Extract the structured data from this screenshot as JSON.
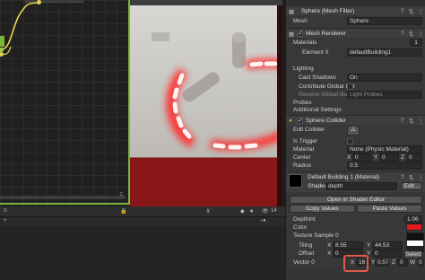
{
  "inspector": {
    "top_tabs": [
      "Tag",
      "Layer"
    ],
    "mesh_filter": {
      "title": "Sphere (Mesh Filter)",
      "mesh_label": "Mesh",
      "mesh_value": "Sphere"
    },
    "mesh_renderer": {
      "title": "Mesh Renderer",
      "materials_label": "Materials",
      "materials_count": "1",
      "element0_label": "Element 0",
      "element0_value": "defaultBuilding1",
      "lighting_label": "Lighting",
      "cast_shadows_label": "Cast Shadows",
      "cast_shadows_value": "On",
      "contribute_gi_label": "Contribute Global Illur",
      "receive_gi_label": "Receive Global Illumi",
      "receive_gi_value": "Light Probes",
      "probes_label": "Probes",
      "additional_label": "Additional Settings"
    },
    "sphere_collider": {
      "title": "Sphere Collider",
      "edit_collider_label": "Edit Collider",
      "is_trigger_label": "Is Trigger",
      "material_label": "Material",
      "material_value": "None (Physic Material)",
      "center_label": "Center",
      "center": {
        "x": "0",
        "y": "0",
        "z": "0"
      },
      "radius_label": "Radius",
      "radius_value": "0.5"
    },
    "material": {
      "title": "Default Building 1 (Material)",
      "shader_label": "Shader",
      "shader_value": "depth",
      "edit_label": "Edit...",
      "open_shader_label": "Open in Shader Editor",
      "copy_values_label": "Copy Values",
      "paste_values_label": "Paste Values",
      "depthint_label": "DepthInt",
      "depthint_value": "1.06",
      "color_label": "Color",
      "texture_label": "Texture Sample 0",
      "tiling_label": "Tiling",
      "tiling": {
        "x": "8.55",
        "y": "44.53"
      },
      "offset_label": "Offset",
      "offset": {
        "x": "0",
        "y": "0"
      },
      "vector_label": "Vector 0",
      "vector": {
        "x": "16",
        "y": "0.57",
        "z": "0",
        "w": "0"
      },
      "select_label": "Select"
    }
  },
  "bottom_toolbar": {
    "count": "14"
  },
  "colors": {
    "graph_border": "#7bb63a",
    "highlight": "#e05a47",
    "glow": "#ff4040",
    "floor": "#8a1717"
  }
}
